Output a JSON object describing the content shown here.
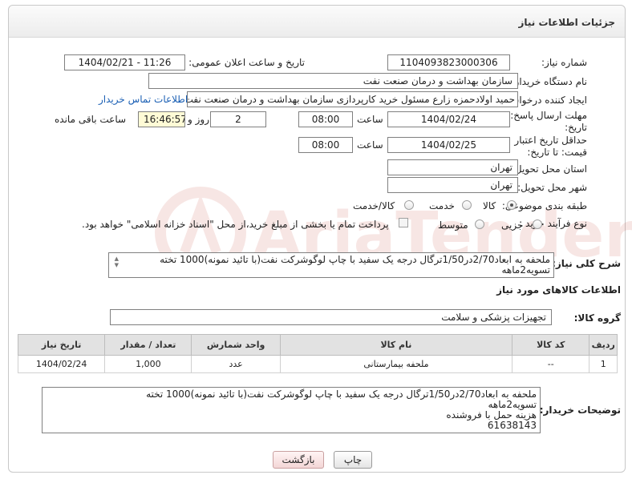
{
  "header": {
    "title": "جزئیات اطلاعات نیاز"
  },
  "fields": {
    "need_number_label": "شماره نیاز:",
    "need_number": "1104093823000306",
    "announce_label": "تاریخ و ساعت اعلان عمومی:",
    "announce_value": "1404/02/21 - 11:26",
    "buyer_org_label": "نام دستگاه خریدار:",
    "buyer_org": "سازمان بهداشت و درمان صنعت نفت",
    "creator_label": "ایجاد کننده درخواست:",
    "creator": "حمید اولادحمزه زارع مسئول خرید کارپردازی سازمان بهداشت و درمان صنعت نفت",
    "contact_link": "اطلاعات تماس خریدار",
    "deadline_label": "مهلت ارسال پاسخ: تا تاریخ:",
    "deadline_date": "1404/02/24",
    "time_label": "ساعت",
    "deadline_time": "08:00",
    "days_value": "2",
    "days_label": "روز و",
    "remaining_time": "16:46:57",
    "remaining_label": "ساعت باقی مانده",
    "validity_label": "حداقل تاریخ اعتبار قیمت: تا تاریخ:",
    "validity_date": "1404/02/25",
    "validity_time": "08:00",
    "province_label": "استان محل تحویل:",
    "province": "تهران",
    "city_label": "شهر محل تحویل:",
    "city": "تهران",
    "category_label": "طبقه بندی موضوعی:",
    "category_options": [
      "کالا",
      "خدمت",
      "کالا/خدمت"
    ],
    "process_label": "نوع فرآیند خرید :",
    "process_options": [
      "جزیی",
      "متوسط"
    ],
    "payment_note": "پرداخت تمام یا بخشی از مبلغ خرید،از محل \"اسناد خزانه اسلامی\" خواهد بود.",
    "overall_desc_label": "شرح کلی نیاز:",
    "overall_desc": "ملحفه به ابعاد2/70در1/50ترگال درجه یک سفید با چاپ لوگوشرکت نفت(با تائید نمونه)1000 تخته تسویه2ماهه",
    "goods_info_label": "اطلاعات کالاهای مورد نیاز",
    "goods_group_label": "گروه کالا:",
    "goods_group": "تجهیزات پزشکی و سلامت"
  },
  "table": {
    "headers": [
      "ردیف",
      "کد کالا",
      "نام کالا",
      "واحد شمارش",
      "تعداد / مقدار",
      "تاریخ نیاز"
    ],
    "rows": [
      [
        "1",
        "--",
        "ملحفه بیمارستانی",
        "عدد",
        "1,000",
        "1404/02/24"
      ]
    ]
  },
  "buyer_notes_label": "توضیحات خریدار:",
  "buyer_notes": [
    "ملحفه به ابعاد2/70در1/50ترگال درجه یک سفید با چاپ لوگوشرکت نفت(با تائید نمونه)1000 تخته",
    "تسویه2ماهه",
    "هزینه حمل با فروشنده",
    "61638143"
  ],
  "buttons": {
    "print": "چاپ",
    "back": "بازگشت"
  },
  "watermark": "AriaTender.neT"
}
